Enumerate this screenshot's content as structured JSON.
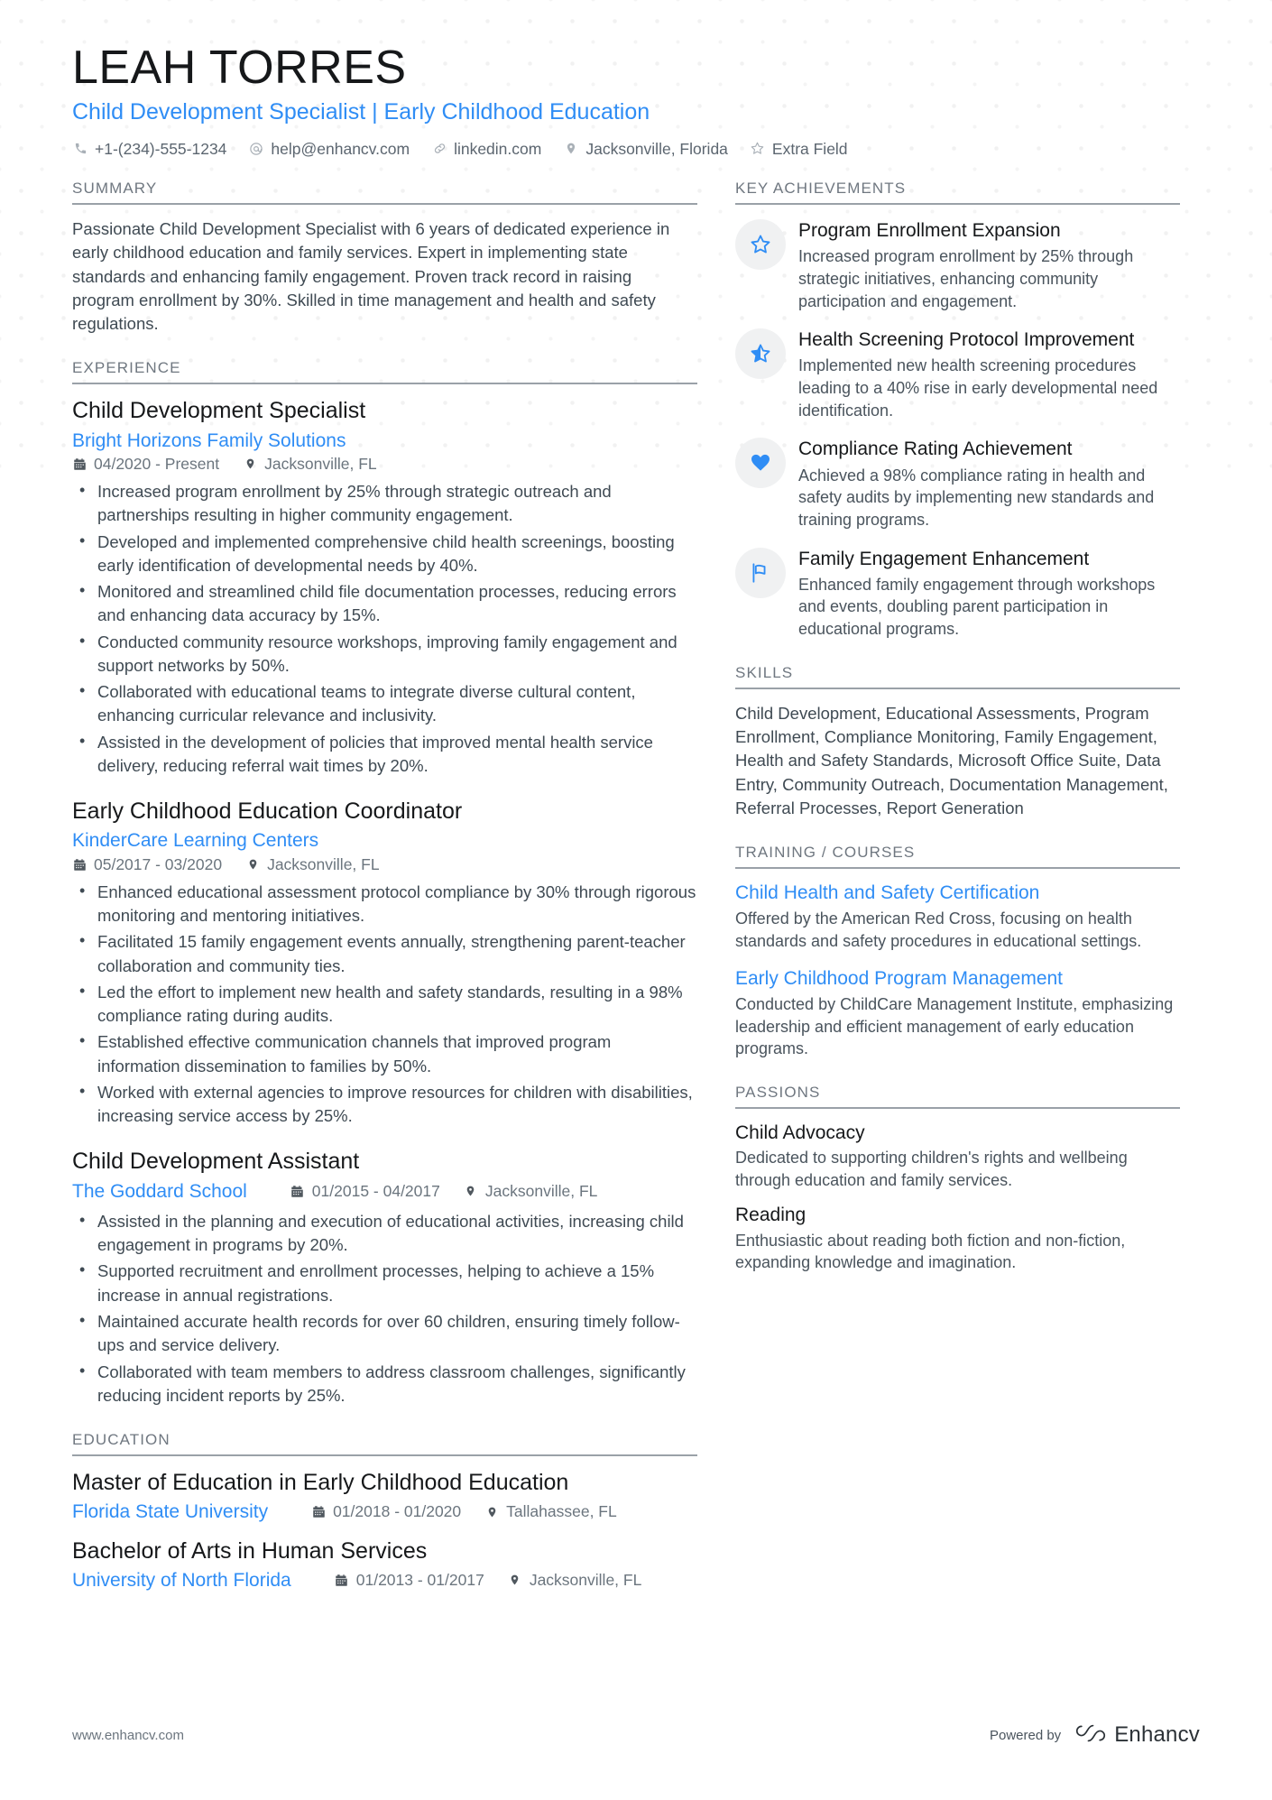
{
  "header": {
    "name": "LEAH TORRES",
    "headline": "Child Development Specialist | Early Childhood Education",
    "contacts": [
      {
        "icon": "phone-icon",
        "text": "+1-(234)-555-1234"
      },
      {
        "icon": "email-icon",
        "text": "help@enhancv.com"
      },
      {
        "icon": "link-icon",
        "text": "linkedin.com"
      },
      {
        "icon": "location-pin-icon",
        "text": "Jacksonville, Florida"
      },
      {
        "icon": "star-outline-icon",
        "text": "Extra Field"
      }
    ]
  },
  "summary": {
    "title": "SUMMARY",
    "text": "Passionate Child Development Specialist with 6 years of dedicated experience in early childhood education and family services. Expert in implementing state standards and enhancing family engagement. Proven track record in raising program enrollment by 30%. Skilled in time management and health and safety regulations."
  },
  "experience": {
    "title": "EXPERIENCE",
    "jobs": [
      {
        "role": "Child Development Specialist",
        "company": "Bright Horizons Family Solutions",
        "dates": "04/2020 - Present",
        "location": "Jacksonville, FL",
        "inline": false,
        "bullets": [
          "Increased program enrollment by 25% through strategic outreach and partnerships resulting in higher community engagement.",
          "Developed and implemented comprehensive child health screenings, boosting early identification of developmental needs by 40%.",
          "Monitored and streamlined child file documentation processes, reducing errors and enhancing data accuracy by 15%.",
          "Conducted community resource workshops, improving family engagement and support networks by 50%.",
          "Collaborated with educational teams to integrate diverse cultural content, enhancing curricular relevance and inclusivity.",
          "Assisted in the development of policies that improved mental health service delivery, reducing referral wait times by 20%."
        ]
      },
      {
        "role": "Early Childhood Education Coordinator",
        "company": "KinderCare Learning Centers",
        "dates": "05/2017 - 03/2020",
        "location": "Jacksonville, FL",
        "inline": false,
        "bullets": [
          "Enhanced educational assessment protocol compliance by 30% through rigorous monitoring and mentoring initiatives.",
          "Facilitated 15 family engagement events annually, strengthening parent-teacher collaboration and community ties.",
          "Led the effort to implement new health and safety standards, resulting in a 98% compliance rating during audits.",
          "Established effective communication channels that improved program information dissemination to families by 50%.",
          "Worked with external agencies to improve resources for children with disabilities, increasing service access by 25%."
        ]
      },
      {
        "role": "Child Development Assistant",
        "company": "The Goddard School",
        "dates": "01/2015 - 04/2017",
        "location": "Jacksonville, FL",
        "inline": true,
        "bullets": [
          "Assisted in the planning and execution of educational activities, increasing child engagement in programs by 20%.",
          "Supported recruitment and enrollment processes, helping to achieve a 15% increase in annual registrations.",
          "Maintained accurate health records for over 60 children, ensuring timely follow-ups and service delivery.",
          "Collaborated with team members to address classroom challenges, significantly reducing incident reports by 25%."
        ]
      }
    ]
  },
  "education": {
    "title": "EDUCATION",
    "entries": [
      {
        "degree": "Master of Education in Early Childhood Education",
        "school": "Florida State University",
        "dates": "01/2018 - 01/2020",
        "location": "Tallahassee, FL"
      },
      {
        "degree": "Bachelor of Arts in Human Services",
        "school": "University of North Florida",
        "dates": "01/2013 - 01/2017",
        "location": "Jacksonville, FL"
      }
    ]
  },
  "key_achievements": {
    "title": "KEY ACHIEVEMENTS",
    "items": [
      {
        "icon": "star-outline-icon",
        "title": "Program Enrollment Expansion",
        "desc": "Increased program enrollment by 25% through strategic initiatives, enhancing community participation and engagement."
      },
      {
        "icon": "star-half-icon",
        "title": "Health Screening Protocol Improvement",
        "desc": "Implemented new health screening procedures leading to a 40% rise in early developmental need identification."
      },
      {
        "icon": "heart-filled-icon",
        "title": "Compliance Rating Achievement",
        "desc": "Achieved a 98% compliance rating in health and safety audits by implementing new standards and training programs."
      },
      {
        "icon": "flag-outline-icon",
        "title": "Family Engagement Enhancement",
        "desc": "Enhanced family engagement through workshops and events, doubling parent participation in educational programs."
      }
    ]
  },
  "skills": {
    "title": "SKILLS",
    "text": "Child Development, Educational Assessments, Program Enrollment, Compliance Monitoring, Family Engagement, Health and Safety Standards, Microsoft Office Suite, Data Entry, Community Outreach, Documentation Management, Referral Processes, Report Generation"
  },
  "training": {
    "title": "TRAINING / COURSES",
    "courses": [
      {
        "name": "Child Health and Safety Certification",
        "desc": "Offered by the American Red Cross, focusing on health standards and safety procedures in educational settings."
      },
      {
        "name": "Early Childhood Program Management",
        "desc": "Conducted by ChildCare Management Institute, emphasizing leadership and efficient management of early education programs."
      }
    ]
  },
  "passions": {
    "title": "PASSIONS",
    "items": [
      {
        "name": "Child Advocacy",
        "desc": "Dedicated to supporting children's rights and wellbeing through education and family services."
      },
      {
        "name": "Reading",
        "desc": "Enthusiastic about reading both fiction and non-fiction, expanding knowledge and imagination."
      }
    ]
  },
  "footer": {
    "url": "www.enhancv.com",
    "powered_by": "Powered by",
    "brand": "Enhancv"
  },
  "colors": {
    "accent": "#2f8df5",
    "heading": "#6f7780",
    "text": "#3f4a53",
    "name": "#16181a",
    "badge_bg": "#f0f1f2"
  }
}
